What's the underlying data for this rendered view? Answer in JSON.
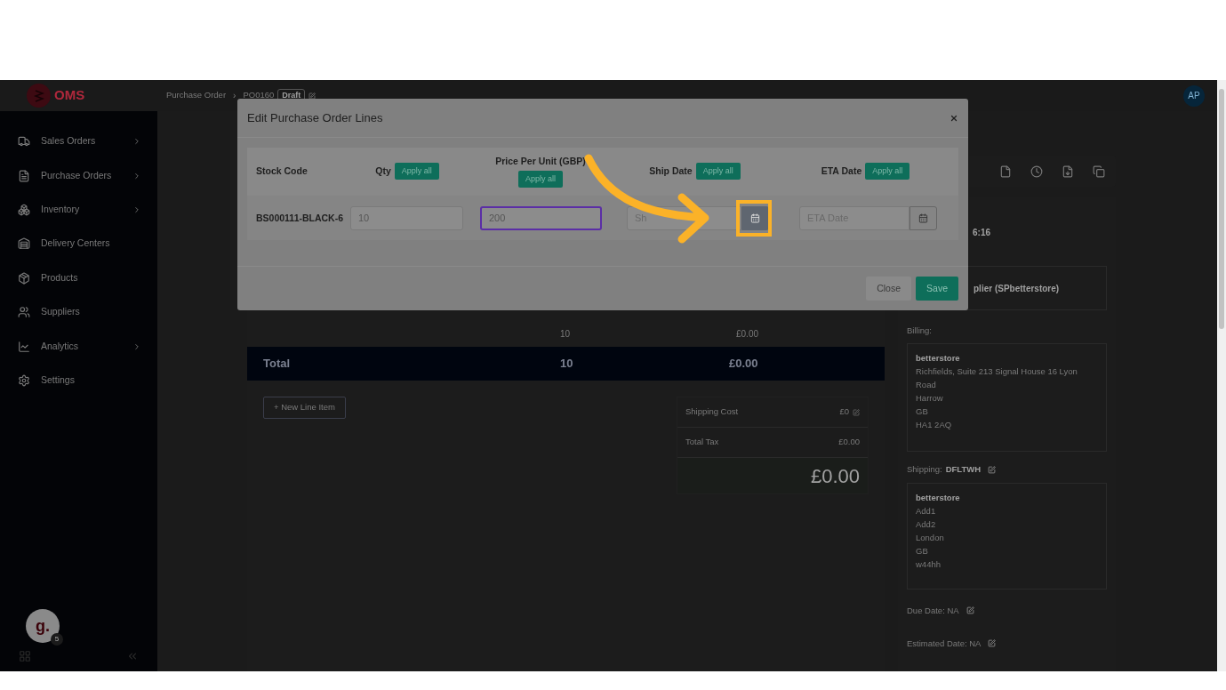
{
  "header": {
    "logo": "OMS",
    "breadcrumb": [
      "Purchase Order",
      "PO0160"
    ],
    "separator": "›",
    "status": "Draft",
    "avatar": "AP"
  },
  "sidebar": {
    "items": [
      {
        "label": "Sales Orders",
        "has_submenu": true
      },
      {
        "label": "Purchase Orders",
        "has_submenu": true
      },
      {
        "label": "Inventory",
        "has_submenu": true
      },
      {
        "label": "Delivery Centers",
        "has_submenu": false
      },
      {
        "label": "Products",
        "has_submenu": false
      },
      {
        "label": "Suppliers",
        "has_submenu": false
      },
      {
        "label": "Analytics",
        "has_submenu": true
      },
      {
        "label": "Settings",
        "has_submenu": false
      }
    ],
    "helper": {
      "letter": "g.",
      "count": "5"
    }
  },
  "order": {
    "subtotal_row": [
      "10",
      "£0.00"
    ],
    "total_row": {
      "label": "Total",
      "qty": "10",
      "amount": "£0.00"
    },
    "new_line_button": "+ New Line Item",
    "summary": [
      {
        "label": "Shipping Cost",
        "value": "£0",
        "editable": true
      },
      {
        "label": "Total Tax",
        "value": "£0.00",
        "editable": false
      }
    ],
    "grand_total": "£0.00"
  },
  "details": {
    "time_fragment": "6:16",
    "supplier_fragment": "plier (SPbetterstore)",
    "billing": {
      "label": "Billing:",
      "name": "betterstore",
      "lines": [
        "Richfields, Suite 213 Signal House 16 Lyon",
        "Road",
        "Harrow",
        "GB",
        "HA1 2AQ"
      ]
    },
    "shipping": {
      "label": "Shipping:",
      "code": "DFLTWH",
      "name": "betterstore",
      "lines": [
        "Add1",
        "Add2",
        "London",
        "GB",
        "w44hh"
      ]
    },
    "dates": [
      {
        "label": "Due Date: NA"
      },
      {
        "label": "Estimated Date: NA"
      }
    ]
  },
  "modal": {
    "title": "Edit Purchase Order Lines",
    "columns": [
      {
        "label": "Stock Code"
      },
      {
        "label": "Qty",
        "action": "Apply all"
      },
      {
        "label": "Price Per Unit (GBP)",
        "action": "Apply all"
      },
      {
        "label": "Ship Date",
        "action": "Apply all"
      },
      {
        "label": "ETA Date",
        "action": "Apply all"
      }
    ],
    "rows": [
      {
        "stock_code": "BS000111-BLACK-6",
        "fields": [
          {
            "kind": "text",
            "value": "10",
            "focused": false
          },
          {
            "kind": "text",
            "value": "200",
            "focused": true
          },
          {
            "kind": "date",
            "placeholder": "Sh",
            "focused": false,
            "highlighted": true
          },
          {
            "kind": "date",
            "placeholder": "ETA Date",
            "focused": false,
            "highlighted": false
          }
        ]
      }
    ],
    "buttons": [
      {
        "label": "Close",
        "primary": false
      },
      {
        "label": "Save",
        "primary": true
      }
    ]
  }
}
